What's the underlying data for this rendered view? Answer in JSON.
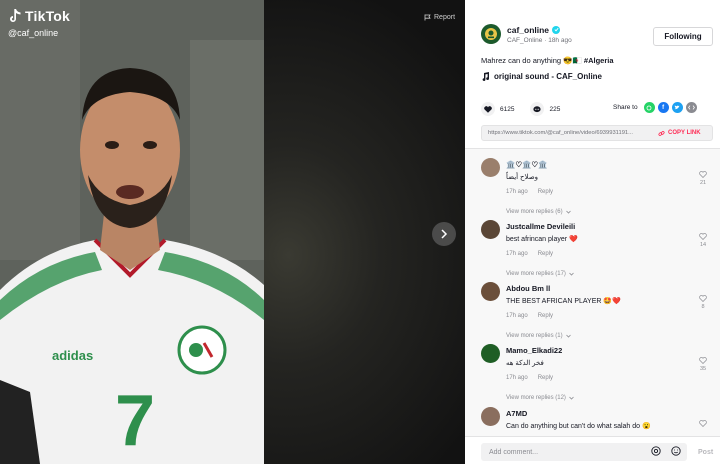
{
  "brand": {
    "name": "TikTok",
    "handle": "@caf_online"
  },
  "video": {
    "report_label": "Report",
    "jersey_number": "7",
    "kit_brand": "adidas"
  },
  "author": {
    "username": "caf_online",
    "display_name": "CAF_Online",
    "separator": "·",
    "posted": "18h ago",
    "follow_label": "Following"
  },
  "caption": {
    "text": "Mahrez can do anything 😎🇩🇿",
    "hashtag": "#Algeria"
  },
  "sound": {
    "title": "original sound - CAF_Online"
  },
  "stats": {
    "likes": "6125",
    "comments": "225",
    "share_label": "Share to"
  },
  "link": {
    "url": "https://www.tiktok.com/@caf_online/video/6939931191...",
    "copy_label": "COPY LINK"
  },
  "comments": [
    {
      "user": "🏛️♡🏛️♡🏛️",
      "text": "وصلاح أيضاً",
      "time": "17h ago",
      "reply": "Reply",
      "likes": "21",
      "view_replies": "View more replies (6)",
      "avatar_color": "#9a7f6c"
    },
    {
      "user": "Justcallme Devileili",
      "text": "best afrincan player ❤️",
      "time": "17h ago",
      "reply": "Reply",
      "likes": "14",
      "view_replies": "View more replies (17)",
      "avatar_color": "#5a4636"
    },
    {
      "user": "Abdou Bm ll",
      "text": "THE BEST AFRICAN PLAYER 🤩❤️",
      "time": "17h ago",
      "reply": "Reply",
      "likes": "8",
      "view_replies": "View more replies (1)",
      "avatar_color": "#6b4f3a"
    },
    {
      "user": "Mamo_Elkadi22",
      "text": "فخر الدكة هه",
      "time": "17h ago",
      "reply": "Reply",
      "likes": "35",
      "view_replies": "View more replies (12)",
      "avatar_color": "#1f5e25"
    },
    {
      "user": "A7MD",
      "text": "Can do anything but can't do what salah do 😮",
      "time": "",
      "reply": "",
      "likes": "",
      "view_replies": "",
      "avatar_color": "#8a6e5e"
    }
  ],
  "composer": {
    "placeholder": "Add comment...",
    "post_label": "Post"
  },
  "colors": {
    "accent": "#fe2c55",
    "verified": "#20d5ec",
    "whatsapp": "#25d366",
    "facebook": "#1877f2",
    "twitter": "#1da1f2"
  }
}
